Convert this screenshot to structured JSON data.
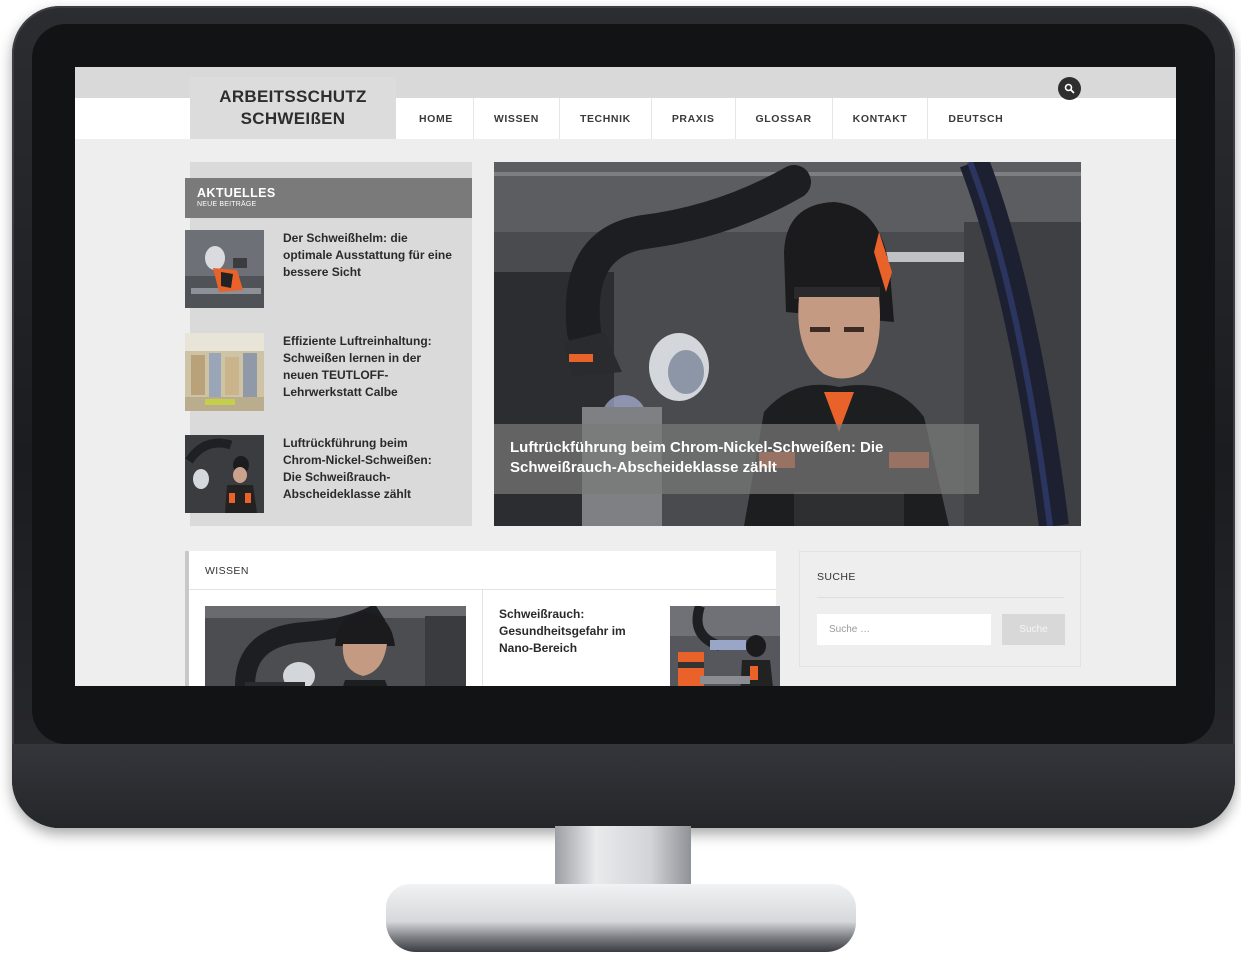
{
  "site": {
    "logo_line1": "ARBEITSSCHUTZ",
    "logo_line2": "SCHWEIßEN"
  },
  "nav": {
    "items": [
      "HOME",
      "WISSEN",
      "TECHNIK",
      "PRAXIS",
      "GLOSSAR",
      "KONTAKT",
      "DEUTSCH"
    ]
  },
  "aktuelles": {
    "title": "AKTUELLES",
    "subtitle": "NEUE BEITRÄGE",
    "items": [
      {
        "title": "Der Schweißhelm: die optimale Ausstattung für eine bessere Sicht"
      },
      {
        "title": "Effiziente Luftreinhaltung: Schweißen lernen in der neuen TEUTLOFF-Lehrwerkstatt Calbe"
      },
      {
        "title": "Luftrückführung beim Chrom-Nickel-Schweißen: Die Schweißrauch-Abscheideklasse zählt"
      }
    ]
  },
  "hero": {
    "caption": "Luftrückführung beim Chrom-Nickel-Schweißen: Die Schweißrauch-Abscheideklasse zählt"
  },
  "wissen": {
    "title": "WISSEN",
    "article_title": "Schweißrauch: Gesundheitsgefahr im Nano-Bereich"
  },
  "suche": {
    "title": "SUCHE",
    "placeholder": "Suche …",
    "button_label": "Suche"
  },
  "colors": {
    "accent_orange": "#e8622a",
    "panel_gray": "#7a7a7a"
  }
}
